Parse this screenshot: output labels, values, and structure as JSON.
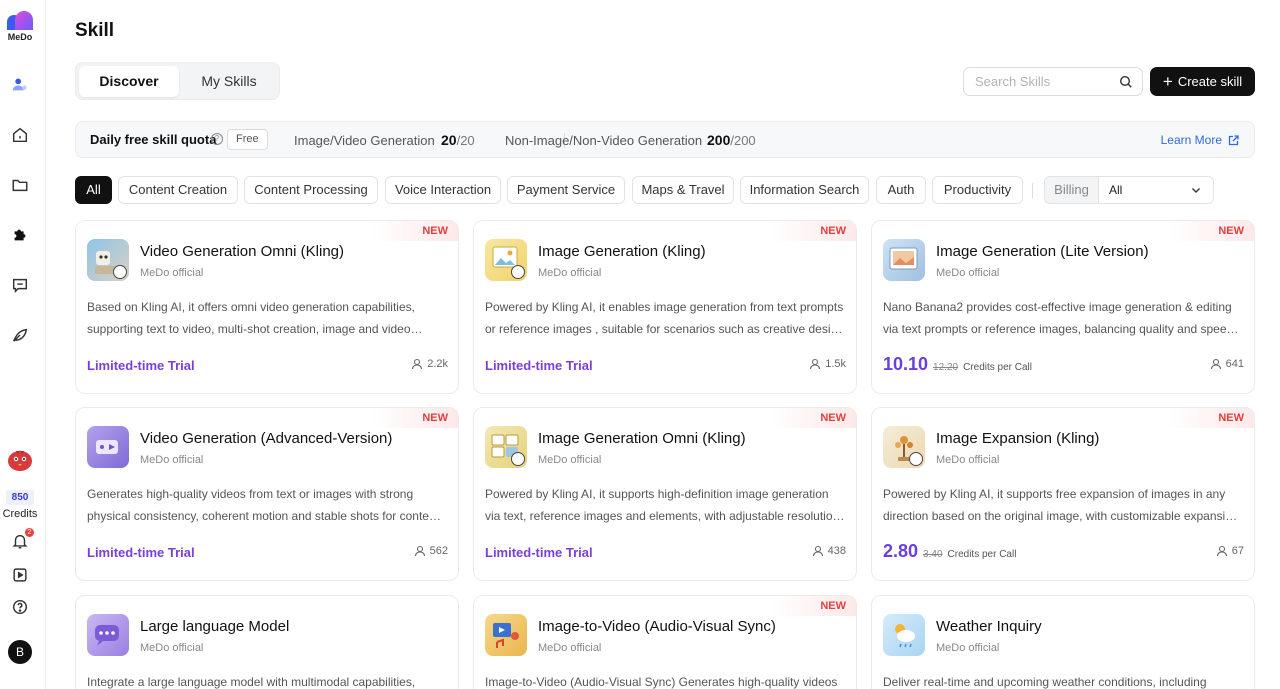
{
  "brand": {
    "logo_text": "MeDo"
  },
  "sidebar": {
    "credits_value": "850",
    "credits_label": "Credits",
    "notif_count": "2",
    "user_initial": "B"
  },
  "header": {
    "title": "Skill"
  },
  "tabs": [
    {
      "label": "Discover"
    },
    {
      "label": "My Skills"
    }
  ],
  "search": {
    "placeholder": "Search Skills",
    "value": ""
  },
  "create_button": {
    "label": "Create skill"
  },
  "quota": {
    "title": "Daily free skill quota",
    "free_badge": "Free",
    "image_video_label": "Image/Video Generation",
    "image_video_used": "20",
    "image_video_total": "/20",
    "other_label": "Non-Image/Non-Video Generation",
    "other_used": "200",
    "other_total": "/200",
    "learn_more": "Learn More"
  },
  "filters": {
    "chips": [
      "All",
      "Content Creation",
      "Content Processing",
      "Voice Interaction",
      "Payment Service",
      "Maps & Travel",
      "Information Search",
      "Auth",
      "Productivity"
    ],
    "billing_label": "Billing",
    "billing_value": "All"
  },
  "cards": [
    {
      "name": "Video Generation Omni (Kling)",
      "author": "MeDo official",
      "new": "NEW",
      "desc": "Based on Kling AI, it offers omni video generation capabilities, supporting text to video, multi-shot creation, image and video reference, and other video generation features.",
      "trial": "Limited-time Trial",
      "users": "2.2k"
    },
    {
      "name": "Image Generation (Kling)",
      "author": "MeDo official",
      "new": "NEW",
      "desc": "Powered by Kling AI, it enables image generation from text prompts or reference images , suitable for scenarios such as creative design and content production.",
      "trial": "Limited-time Trial",
      "users": "1.5k"
    },
    {
      "name": "Image Generation (Lite Version)",
      "author": "MeDo official",
      "new": "NEW",
      "desc": "Nano Banana2 provides cost-effective image generation & editing via text prompts or reference images, balancing quality and speed. Ideal for everyday creation.",
      "price_new": "10.10",
      "price_old": "12.20",
      "price_unit": "Credits per Call",
      "users": "641"
    },
    {
      "name": "Video Generation (Advanced-Version)",
      "author": "MeDo official",
      "new": "NEW",
      "desc": "Generates high-quality videos from text or images with strong physical consistency, coherent motion and stable shots for content creation.",
      "trial": "Limited-time Trial",
      "users": "562"
    },
    {
      "name": "Image Generation Omni (Kling)",
      "author": "MeDo official",
      "new": "NEW",
      "desc": "Powered by Kling AI, it supports high-definition image generation via text, reference images and elements, with adjustable resolution and aspect ratio.",
      "trial": "Limited-time Trial",
      "users": "438"
    },
    {
      "name": "Image Expansion (Kling)",
      "author": "MeDo official",
      "new": "NEW",
      "desc": "Powered by Kling AI, it supports free expansion of images in any direction based on the original image, with customizable expansion ratios.",
      "price_new": "2.80",
      "price_old": "3.40",
      "price_unit": "Credits per Call",
      "users": "67"
    },
    {
      "name": "Large language Model",
      "author": "MeDo official",
      "new": "",
      "desc": "Integrate a large language model with multimodal capabilities,"
    },
    {
      "name": "Image-to-Video (Audio-Visual Sync)",
      "author": "MeDo official",
      "new": "NEW",
      "desc": "Image-to-Video (Audio-Visual Sync) Generates high-quality videos"
    },
    {
      "name": "Weather Inquiry",
      "author": "MeDo official",
      "new": "",
      "desc": "Deliver real-time and upcoming weather conditions, including"
    }
  ],
  "icons": {
    "sidebar": [
      "agents-icon",
      "home-icon",
      "folder-icon",
      "plugin-icon",
      "chat-icon",
      "pen-icon",
      "bell-icon",
      "play-icon",
      "help-icon"
    ],
    "search": "search-icon",
    "learn_more": "external-link-icon",
    "users": "user-icon"
  },
  "colors": {
    "accent_purple": "#7a3fd6",
    "price_purple": "#6a3fe0",
    "new_red": "#e04040",
    "link_blue": "#2f6bd8",
    "primary_black": "#111111"
  }
}
